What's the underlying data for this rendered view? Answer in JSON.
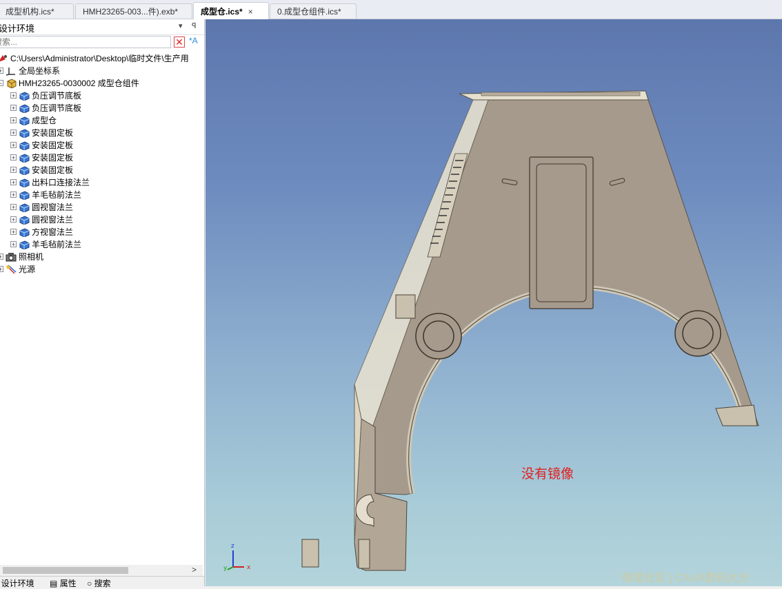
{
  "tabs": [
    {
      "label": "成型机构.ics*",
      "active": false
    },
    {
      "label": "HMH23265-003...件).exb*",
      "active": false
    },
    {
      "label": "成型仓.ics*",
      "active": true
    },
    {
      "label": "0.成型仓组件.ics*",
      "active": false
    }
  ],
  "tab_close": "×",
  "panel": {
    "title": "设计环境",
    "dropdown_icon": "▾",
    "pin_icon": "ꟼ",
    "search_placeholder": "搜索...",
    "tree": {
      "root": "C:\\Users\\Administrator\\Desktop\\临时文件\\生产用",
      "global_cs": "全局坐标系",
      "assembly": "HMH23265-0030002 成型仓组件",
      "parts": [
        "负压调节底板",
        "负压调节底板",
        "成型仓",
        "安装固定板",
        "安装固定板",
        "安装固定板",
        "安装固定板",
        "出料口连接法兰",
        "羊毛毡前法兰",
        "圆视窗法兰",
        "圆视窗法兰",
        "方视窗法兰",
        "羊毛毡前法兰"
      ],
      "camera": "照相机",
      "light": "光源"
    },
    "bottom_tabs": {
      "design": "设计环境",
      "properties": "属性",
      "search": "搜索"
    }
  },
  "viewport": {
    "annotation": "没有镜像",
    "watermark": "微笔社区 | CAXA数码大方",
    "axis": {
      "x": "x",
      "y": "y",
      "z": "z"
    }
  },
  "colors": {
    "part_face": "#a69a8c",
    "part_edge": "#d8d2c2",
    "annotation": "#e02020",
    "bg_top": "#5d77ad",
    "bg_bottom": "#b3d4da"
  }
}
